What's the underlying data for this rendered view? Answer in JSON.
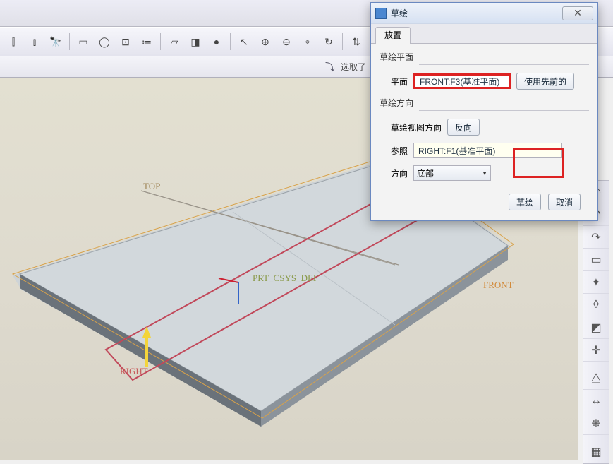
{
  "dialog": {
    "title": "草绘",
    "close_glyph": "✕",
    "tab_placement": "放置",
    "group_plane_label": "草绘平面",
    "plane_label": "平面",
    "plane_value": "FRONT:F3(基准平面)",
    "use_prev_btn": "使用先前的",
    "group_dir_label": "草绘方向",
    "view_dir_label": "草绘视图方向",
    "reverse_btn": "反向",
    "ref_label": "参照",
    "ref_value": "RIGHT:F1(基准平面)",
    "orient_label": "方向",
    "orient_value": "底部",
    "sketch_btn": "草绘",
    "cancel_btn": "取消"
  },
  "substrip": {
    "select_label": "选取了"
  },
  "viewport": {
    "top_label": "TOP",
    "right_label": "RIGHT",
    "front_label": "FRONT",
    "csys_label": "PRT_CSYS_DEF"
  },
  "toolbar": {
    "icons": [
      "split-vert-icon",
      "split-horz-icon",
      "binoculars-icon",
      "sep",
      "box-select-icon",
      "lasso-icon",
      "node-select-icon",
      "filter-icon",
      "sep",
      "cube-wire-icon",
      "cube-shaded-icon",
      "sphere-icon",
      "sep",
      "arrow-cursor-icon",
      "zoom-in-icon",
      "zoom-out-icon",
      "zoom-fit-icon",
      "refresh-icon",
      "sep",
      "orient-icon",
      "layers-icon",
      "layers-filter-icon",
      "sep",
      "view-settings-icon",
      "sep",
      "panel-icon"
    ],
    "glyphs": {
      "split-vert-icon": "⫿",
      "split-horz-icon": "⫾",
      "binoculars-icon": "🔭",
      "box-select-icon": "▭",
      "lasso-icon": "◯",
      "node-select-icon": "⊡",
      "filter-icon": "≔",
      "cube-wire-icon": "▱",
      "cube-shaded-icon": "◨",
      "sphere-icon": "●",
      "arrow-cursor-icon": "↖",
      "zoom-in-icon": "⊕",
      "zoom-out-icon": "⊖",
      "zoom-fit-icon": "⌖",
      "refresh-icon": "↻",
      "orient-icon": "⇅",
      "layers-icon": "≣",
      "layers-filter-icon": "⧉",
      "view-settings-icon": "◉",
      "panel-icon": "▤"
    }
  },
  "rail": {
    "icons": [
      "arc-icon",
      "curve-lt-icon",
      "curve-rt-icon",
      "plane-tool-icon",
      "ref-tool-icon",
      "sketch-plane-icon",
      "region-icon",
      "csys-icon",
      "sep",
      "mirror-icon",
      "align-icon",
      "pattern-icon",
      "sep",
      "grid-icon"
    ],
    "glyphs": {
      "arc-icon": "◠",
      "curve-lt-icon": "↶",
      "curve-rt-icon": "↷",
      "plane-tool-icon": "▭",
      "ref-tool-icon": "✦",
      "sketch-plane-icon": "◊",
      "region-icon": "◩",
      "csys-icon": "✛",
      "mirror-icon": "⧋",
      "align-icon": "↔",
      "pattern-icon": "⁜",
      "grid-icon": "▦"
    }
  }
}
